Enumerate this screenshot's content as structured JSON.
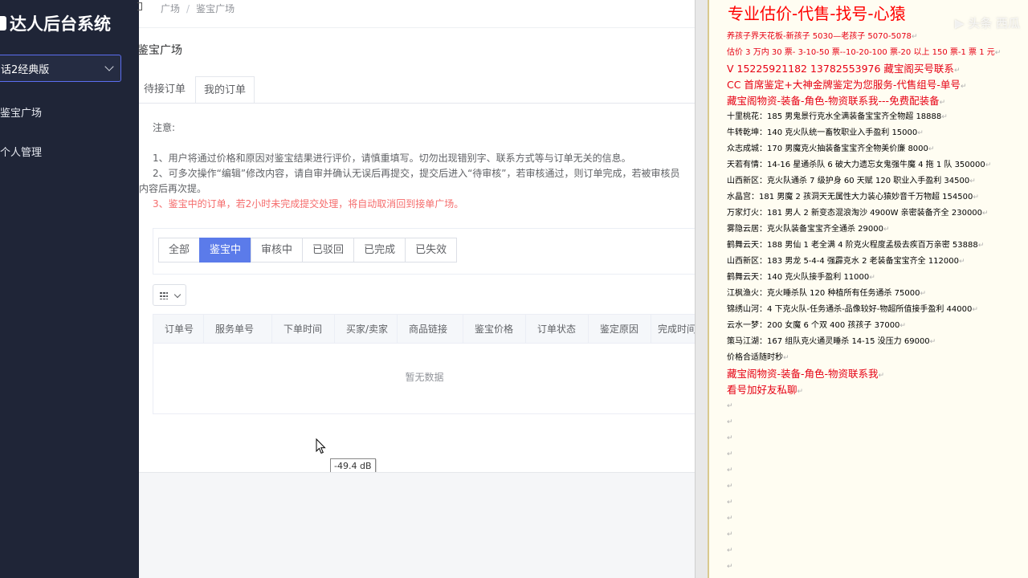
{
  "sidebar": {
    "brand": "达人后台系统",
    "version_selector": "话2经典版",
    "nav": [
      "鉴宝广场",
      "个人管理"
    ]
  },
  "main": {
    "breadcrumb": [
      "广场",
      "鉴宝广场"
    ],
    "page_title": "鉴宝广场",
    "tabs": [
      "待接订单",
      "我的订单"
    ],
    "notes_title": "注意:",
    "notes": [
      "1、用户将通过价格和原因对鉴宝结果进行评价，请慎重填写。切勿出现错别字、联系方式等与订单无关的信息。",
      "2、可多次操作“编辑”修改内容，请自审并确认无误后再提交，提交后进入“待审核”，若审核通过，则订单完成，若被审核员",
      "内容后再次提。"
    ],
    "warning": "3、鉴宝中的订单，若2小时未完成提交处理，将自动取消回到接单广场。",
    "filters": [
      "全部",
      "鉴宝中",
      "审核中",
      "已驳回",
      "已完成",
      "已失效"
    ],
    "table_headers": [
      "订单号",
      "服务单号",
      "下单时间",
      "买家/卖家",
      "商品链接",
      "鉴宝价格",
      "订单状态",
      "鉴定原因",
      "完成时间"
    ],
    "empty_text": "暂无数据",
    "tooltip": "-49.4 dB"
  },
  "doc": {
    "title": "专业估价-代售-找号-心猿",
    "watermark": "▶ 头条 西瓜",
    "lines": [
      {
        "text": "养孩子界天花板-新孩子 5030—老孩子 5070-5078",
        "style": "red"
      },
      {
        "text": "估价 3 万内 30 票- 3-10-50 票--10-20-100 票-20 以上 150 票-1 票 1 元",
        "style": "red"
      },
      {
        "text": "V 15225921182      13782553976    藏宝阁买号联系",
        "style": "red big"
      },
      {
        "text": "CC 首席鉴定+大神金牌鉴定为您服务-代售组号-单号",
        "style": "red big"
      },
      {
        "text": "藏宝阁物资-装备-角色-物资联系我---免费配装备",
        "style": "red big"
      },
      {
        "text": "十里桃花：185 男鬼景行克水全满装备宝宝齐全物超 18888",
        "style": ""
      },
      {
        "text": "牛转乾坤：140 克火队统一畜牧职业入手盈利 15000",
        "style": ""
      },
      {
        "text": "众志成城：170 男魔克火抽装备宝宝齐全物美价廉 8000",
        "style": ""
      },
      {
        "text": "天若有情：14-16 星通杀队 6 破大力遗忘女鬼强牛魔 4 拖 1 队 350000",
        "style": ""
      },
      {
        "text": "山西新区：克火队通杀 7 级护身 60 天赋 120 职业入手盈利 34500",
        "style": ""
      },
      {
        "text": "水晶宫：181 男魔 2 孩洞天无属性大力装心猿妙音千万物超 154500",
        "style": ""
      },
      {
        "text": "万家灯火：181 男人 2 新变态混浪淘沙 4900W 亲密装备齐全 230000",
        "style": ""
      },
      {
        "text": "雾隐云居：克火队装备宝宝齐全通杀 29000",
        "style": ""
      },
      {
        "text": "鹤舞云天：188 男仙 1 老全满 4 阶克火程度孟极去疾百万亲密 53888",
        "style": ""
      },
      {
        "text": "山西新区：183 男龙 5-4-4 强霹克水 2 老装备宝宝齐全 112000",
        "style": ""
      },
      {
        "text": "鹤舞云天：140 克火队接手盈利 11000",
        "style": ""
      },
      {
        "text": "江枫渔火：克火睡杀队 120 种植所有任务通杀 75000",
        "style": ""
      },
      {
        "text": "锦绣山河：4 下克火队-任务通杀-品像较好-物超所值接手盈利 44000",
        "style": ""
      },
      {
        "text": "云水一梦：200 女魔 6 个双 400 孩孩子 37000",
        "style": ""
      },
      {
        "text": "策马江湖：167 组队克火通灵睡杀 14-15 没压力 69000",
        "style": ""
      },
      {
        "text": "价格合适随时秒",
        "style": ""
      },
      {
        "text": "藏宝阁物资-装备-角色-物资联系我",
        "style": "red big"
      },
      {
        "text": "看号加好友私聊",
        "style": "red big"
      }
    ],
    "paragraph_mark": "↵"
  }
}
